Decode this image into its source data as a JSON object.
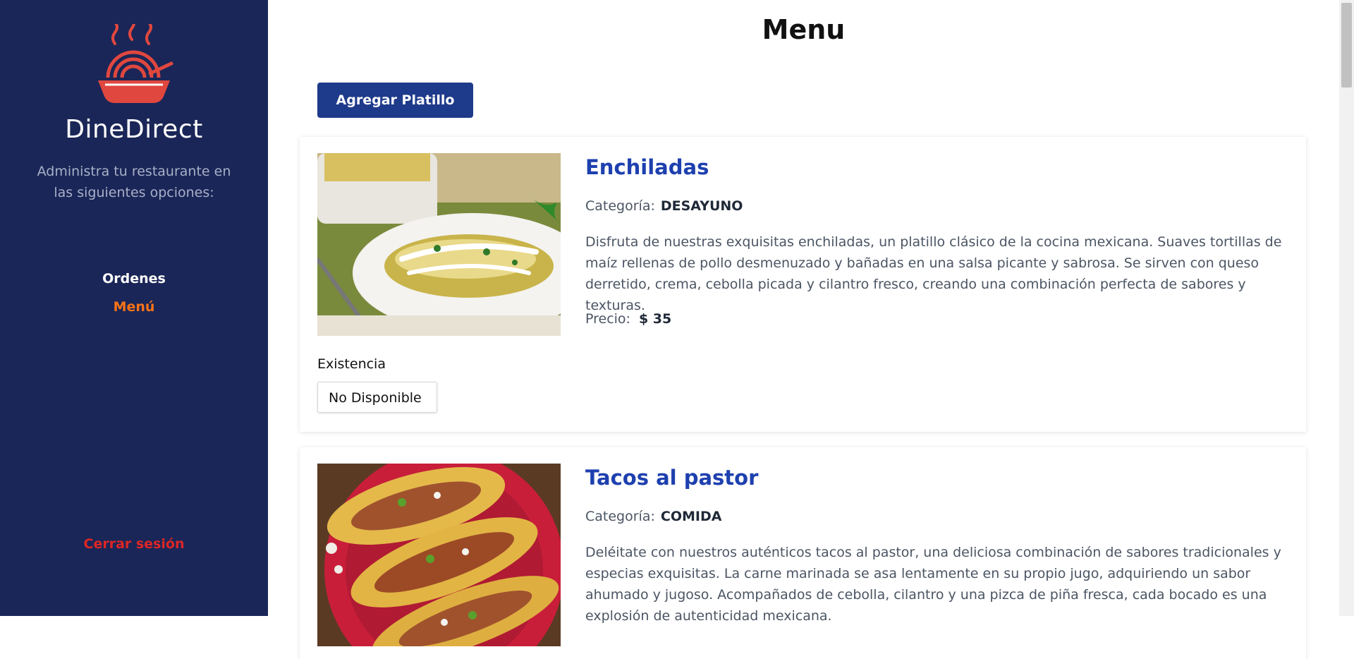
{
  "sidebar": {
    "brand": "DineDirect",
    "tagline": "Administra tu restaurante en las siguientes opciones:",
    "nav": [
      {
        "label": "Ordenes"
      },
      {
        "label": "Menú"
      }
    ],
    "logout": "Cerrar sesión",
    "colors": {
      "bg": "#1a2657",
      "active": "#f97316",
      "logout": "#dc2626",
      "logo": "#e0473e"
    }
  },
  "main": {
    "title": "Menu",
    "add_button": "Agregar Platillo",
    "dishes": [
      {
        "name": "Enchiladas",
        "category_label": "Categoría:",
        "category": "DESAYUNO",
        "description": "Disfruta de nuestras exquisitas enchiladas, un platillo clásico de la cocina mexicana. Suaves tortillas de maíz rellenas de pollo desmenuzado y bañadas en una salsa picante y sabrosa. Se sirven con queso derretido, crema, cebolla picada y cilantro fresco, creando una combinación perfecta de sabores y texturas.",
        "price_label": "Precio:",
        "price": "$ 35",
        "stock_label": "Existencia",
        "stock_value": "No Disponible"
      },
      {
        "name": "Tacos al pastor",
        "category_label": "Categoría:",
        "category": "COMIDA",
        "description": "Deléitate con nuestros auténticos tacos al pastor, una deliciosa combinación de sabores tradicionales y especias exquisitas. La carne marinada se asa lentamente en su propio jugo, adquiriendo un sabor ahumado y jugoso. Acompañados de cebolla, cilantro y una pizca de piña fresca, cada bocado es una explosión de autenticidad mexicana."
      }
    ]
  }
}
